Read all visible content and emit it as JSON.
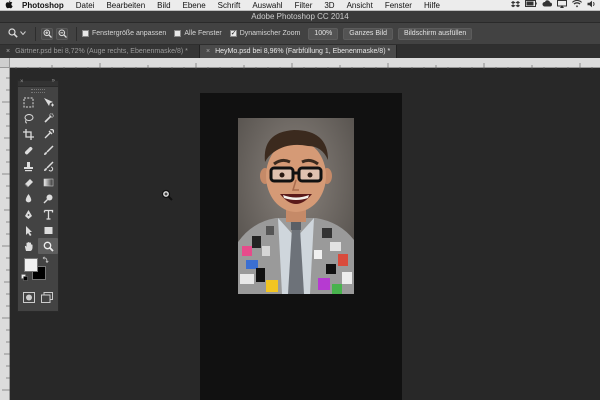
{
  "menubar": {
    "app_name": "Photoshop",
    "items": [
      "Datei",
      "Bearbeiten",
      "Bild",
      "Ebene",
      "Schrift",
      "Auswahl",
      "Filter",
      "3D",
      "Ansicht",
      "Fenster",
      "Hilfe"
    ]
  },
  "window": {
    "title": "Adobe Photoshop CC 2014"
  },
  "options": {
    "checkbox_fit": "Fenstergröße anpassen",
    "checkbox_all": "Alle Fenster",
    "checkbox_dynamic": "Dynamischer Zoom",
    "zoom_100": "100%",
    "fit_screen": "Ganzes Bild",
    "fill_screen": "Bildschirm ausfüllen"
  },
  "tabs": [
    {
      "label": "Gärtner.psd bei 8,72% (Auge rechts, Ebenenmaske/8) *",
      "close": "×"
    },
    {
      "label": "HeyMo.psd bei 8,96% (Farbfüllung 1, Ebenenmaske/8) *",
      "close": "×"
    }
  ],
  "tools_panel": {
    "close": "×",
    "collapse": "»"
  },
  "colors": {
    "foreground": "#f0f0f0",
    "background": "#000000",
    "ui_dark": "#282828",
    "panel": "#434343"
  },
  "icons": {
    "active_tool": "zoom-icon",
    "cursor": "zoom-cursor-icon"
  }
}
